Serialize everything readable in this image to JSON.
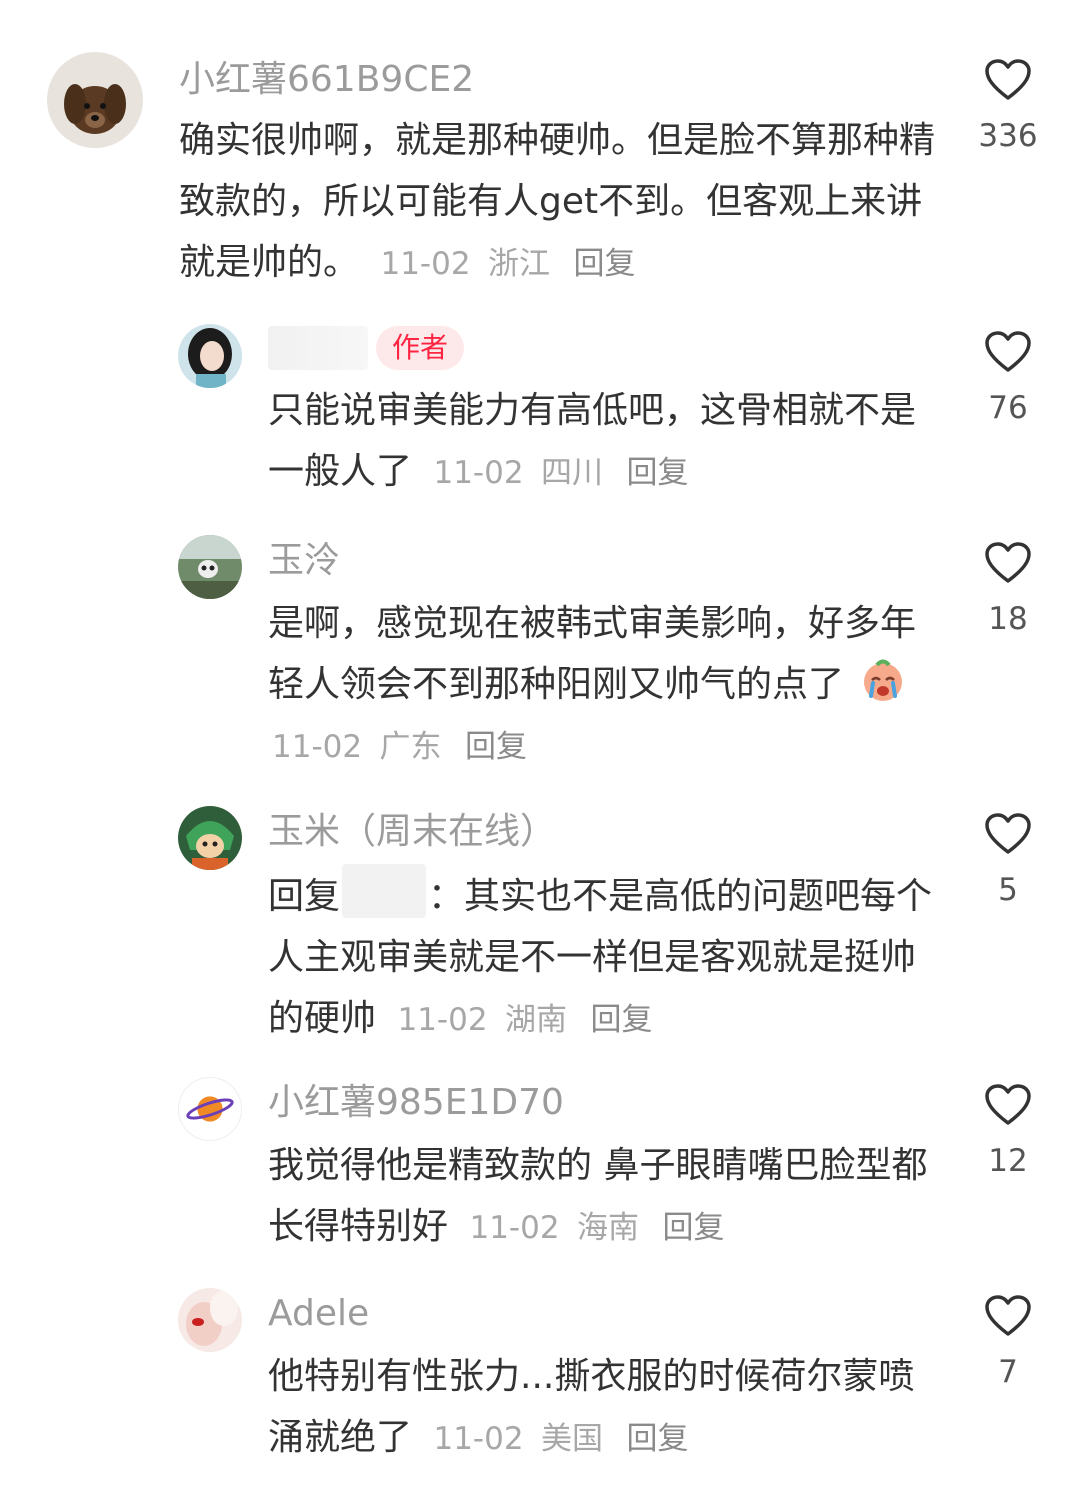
{
  "comments": [
    {
      "username": "小红薯661B9CE2",
      "text": "确实很帅啊，就是那种硬帅。但是脸不算那种精致款的，所以可能有人get不到。但客观上来讲就是帅的。",
      "date": "11-02",
      "location": "浙江",
      "reply_label": "回复",
      "likes": "336"
    },
    {
      "username": "",
      "badge": "作者",
      "text": "只能说审美能力有高低吧，这骨相就不是一般人了",
      "date": "11-02",
      "location": "四川",
      "reply_label": "回复",
      "likes": "76"
    },
    {
      "username": "玉泠",
      "text": "是啊，感觉现在被韩式审美影响，好多年轻人领会不到那种阳刚又帅气的点了",
      "date": "11-02",
      "location": "广东",
      "reply_label": "回复",
      "likes": "18"
    },
    {
      "username": "玉米（周末在线）",
      "reply_prefix": "回复",
      "text": "：其实也不是高低的问题吧每个人主观审美就是不一样但是客观就是挺帅的硬帅",
      "date": "11-02",
      "location": "湖南",
      "reply_label": "回复",
      "likes": "5"
    },
    {
      "username": "小红薯985E1D70",
      "text": "我觉得他是精致款的 鼻子眼睛嘴巴脸型都长得特别好",
      "date": "11-02",
      "location": "海南",
      "reply_label": "回复",
      "likes": "12"
    },
    {
      "username": "Adele",
      "text": "他特别有性张力...撕衣服的时候荷尔蒙喷涌就绝了",
      "date": "11-02",
      "location": "美国",
      "reply_label": "回复",
      "likes": "7"
    }
  ],
  "icons": {
    "like": "heart-outline-icon",
    "emoji": "crying-emoji"
  },
  "colors": {
    "username": "#9b9b9b",
    "meta": "#a7a7a7",
    "badge_bg": "#fde8ea",
    "badge_text": "#ff2442"
  }
}
